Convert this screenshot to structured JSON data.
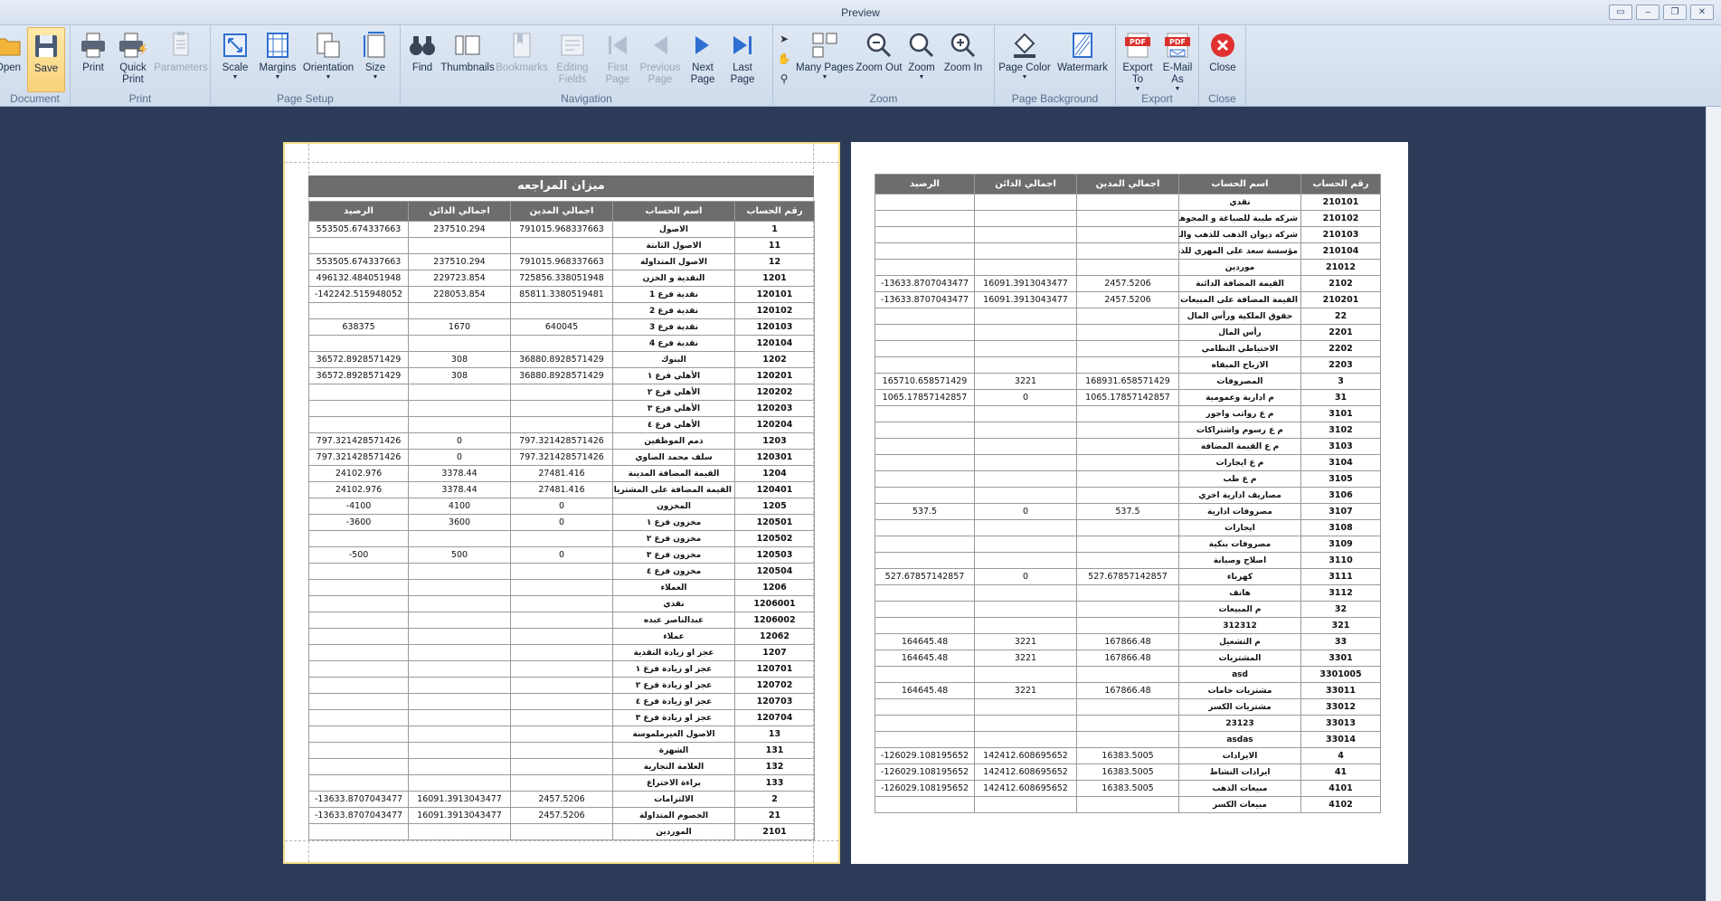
{
  "window": {
    "title": "Preview"
  },
  "ribbon": {
    "groups": {
      "document": "Document",
      "print": "Print",
      "page_setup": "Page Setup",
      "navigation": "Navigation",
      "zoom": "Zoom",
      "page_background": "Page Background",
      "export": "Export",
      "close": "Close"
    },
    "buttons": {
      "open": "Open",
      "save": "Save",
      "print": "Print",
      "quick_print": "Quick Print",
      "parameters": "Parameters",
      "scale": "Scale",
      "margins": "Margins",
      "orientation": "Orientation",
      "size": "Size",
      "find": "Find",
      "thumbnails": "Thumbnails",
      "bookmarks": "Bookmarks",
      "editing_fields": "Editing Fields",
      "first_page": "First Page",
      "previous_page": "Previous Page",
      "next_page": "Next Page",
      "last_page": "Last Page",
      "many_pages": "Many Pages",
      "zoom_out": "Zoom Out",
      "zoom": "Zoom",
      "zoom_in": "Zoom In",
      "page_color": "Page Color",
      "watermark": "Watermark",
      "export_to": "Export To",
      "email_as": "E-Mail As",
      "close": "Close"
    }
  },
  "report": {
    "title": "ميزان المراجعه",
    "headers": [
      "الرصيد",
      "اجمالي الدائن",
      "اجمالي المدين",
      "اسم الحساب",
      "رقم الحساب"
    ],
    "page1_rows": [
      [
        "553505.674337663",
        "237510.294",
        "791015.968337663",
        "الاصول",
        "1"
      ],
      [
        "",
        "",
        "",
        "الاصول الثابتة",
        "11"
      ],
      [
        "553505.674337663",
        "237510.294",
        "791015.968337663",
        "الاصول المتداولة",
        "12"
      ],
      [
        "496132.484051948",
        "229723.854",
        "725856.338051948",
        "النقدية و الخزن",
        "1201"
      ],
      [
        "-142242.515948052",
        "228053.854",
        "85811.3380519481",
        "نقدية فرع 1",
        "120101"
      ],
      [
        "",
        "",
        "",
        "نقدية فرع 2",
        "120102"
      ],
      [
        "638375",
        "1670",
        "640045",
        "نقدية فرع 3",
        "120103"
      ],
      [
        "",
        "",
        "",
        "نقدية فرع 4",
        "120104"
      ],
      [
        "36572.8928571429",
        "308",
        "36880.8928571429",
        "البنوك",
        "1202"
      ],
      [
        "36572.8928571429",
        "308",
        "36880.8928571429",
        "الأهلي فرع ١",
        "120201"
      ],
      [
        "",
        "",
        "",
        "الأهلي فرع ٢",
        "120202"
      ],
      [
        "",
        "",
        "",
        "الأهلي فرع ٣",
        "120203"
      ],
      [
        "",
        "",
        "",
        "الأهلي فرع ٤",
        "120204"
      ],
      [
        "797.321428571426",
        "0",
        "797.321428571426",
        "ذمم الموظفين",
        "1203"
      ],
      [
        "797.321428571426",
        "0",
        "797.321428571426",
        "سلف محمد الصاوي",
        "120301"
      ],
      [
        "24102.976",
        "3378.44",
        "27481.416",
        "القيمة المضافة المدينة",
        "1204"
      ],
      [
        "24102.976",
        "3378.44",
        "27481.416",
        "القيمة المضافة على المشتريات",
        "120401"
      ],
      [
        "-4100",
        "4100",
        "0",
        "المخزون",
        "1205"
      ],
      [
        "-3600",
        "3600",
        "0",
        "مخزون فرع ١",
        "120501"
      ],
      [
        "",
        "",
        "",
        "مخزون فرع ٢",
        "120502"
      ],
      [
        "-500",
        "500",
        "0",
        "مخزون فرع ٣",
        "120503"
      ],
      [
        "",
        "",
        "",
        "مخزون فرع ٤",
        "120504"
      ],
      [
        "",
        "",
        "",
        "العملاء",
        "1206"
      ],
      [
        "",
        "",
        "",
        "نقدي",
        "1206001"
      ],
      [
        "",
        "",
        "",
        "عبدالناصر عبده",
        "1206002"
      ],
      [
        "",
        "",
        "",
        "عملاء",
        "12062"
      ],
      [
        "",
        "",
        "",
        "عجز او زيادة النقدية",
        "1207"
      ],
      [
        "",
        "",
        "",
        "عجز او زيادة فرع ١",
        "120701"
      ],
      [
        "",
        "",
        "",
        "عجز او زيادة فرع ٢",
        "120702"
      ],
      [
        "",
        "",
        "",
        "عجز او زيادة فرع ٤",
        "120703"
      ],
      [
        "",
        "",
        "",
        "عجز او زيادة فرع ٣",
        "120704"
      ],
      [
        "",
        "",
        "",
        "الاصول الغيرملموسة",
        "13"
      ],
      [
        "",
        "",
        "",
        "الشهرة",
        "131"
      ],
      [
        "",
        "",
        "",
        "العلامة التجارية",
        "132"
      ],
      [
        "",
        "",
        "",
        "براءة الاختراع",
        "133"
      ],
      [
        "-13633.8707043477",
        "16091.3913043477",
        "2457.5206",
        "الالتزامات",
        "2"
      ],
      [
        "-13633.8707043477",
        "16091.3913043477",
        "2457.5206",
        "الخصوم المتداولة",
        "21"
      ],
      [
        "",
        "",
        "",
        "الموردين",
        "2101"
      ]
    ],
    "page2_rows": [
      [
        "",
        "",
        "",
        "نقدي",
        "210101"
      ],
      [
        "",
        "",
        "",
        "شركه طيبة للصياغة و المجوهرات المحدودة",
        "210102"
      ],
      [
        "",
        "",
        "",
        "شركه ديوان الذهب للذهب والمجوهرات",
        "210103"
      ],
      [
        "",
        "",
        "",
        "مؤسسة سعد على المهري للذهب",
        "210104"
      ],
      [
        "",
        "",
        "",
        "موردين",
        "21012"
      ],
      [
        "-13633.8707043477",
        "16091.3913043477",
        "2457.5206",
        "القيمة المضافة الدائنة",
        "2102"
      ],
      [
        "-13633.8707043477",
        "16091.3913043477",
        "2457.5206",
        "القيمة المضافة على المبيعات",
        "210201"
      ],
      [
        "",
        "",
        "",
        "حقوق الملكية ورأس المال",
        "22"
      ],
      [
        "",
        "",
        "",
        "رأس المال",
        "2201"
      ],
      [
        "",
        "",
        "",
        "الاحتياطي النظامي",
        "2202"
      ],
      [
        "",
        "",
        "",
        "الارباح المبقاه",
        "2203"
      ],
      [
        "165710.658571429",
        "3221",
        "168931.658571429",
        "المصروفات",
        "3"
      ],
      [
        "1065.17857142857",
        "0",
        "1065.17857142857",
        "م ادارية وعمومية",
        "31"
      ],
      [
        "",
        "",
        "",
        "م ع رواتب واجور",
        "3101"
      ],
      [
        "",
        "",
        "",
        "م ع رسوم واشتراكات",
        "3102"
      ],
      [
        "",
        "",
        "",
        "م ع القيمة المضافة",
        "3103"
      ],
      [
        "",
        "",
        "",
        "م ع ايجارات",
        "3104"
      ],
      [
        "",
        "",
        "",
        "م ع طب",
        "3105"
      ],
      [
        "",
        "",
        "",
        "مصاريف ادارية اخري",
        "3106"
      ],
      [
        "537.5",
        "0",
        "537.5",
        "مصروفات ادارية",
        "3107"
      ],
      [
        "",
        "",
        "",
        "ايجارات",
        "3108"
      ],
      [
        "",
        "",
        "",
        "مصروفات بنكية",
        "3109"
      ],
      [
        "",
        "",
        "",
        "اصلاح وصيانة",
        "3110"
      ],
      [
        "527.67857142857",
        "0",
        "527.67857142857",
        "كهرباء",
        "3111"
      ],
      [
        "",
        "",
        "",
        "هاتف",
        "3112"
      ],
      [
        "",
        "",
        "",
        "م المبيعات",
        "32"
      ],
      [
        "",
        "",
        "",
        "312312",
        "321"
      ],
      [
        "164645.48",
        "3221",
        "167866.48",
        "م التشغيل",
        "33"
      ],
      [
        "164645.48",
        "3221",
        "167866.48",
        "المشتريات",
        "3301"
      ],
      [
        "",
        "",
        "",
        "asd",
        "3301005"
      ],
      [
        "164645.48",
        "3221",
        "167866.48",
        "مشتريات خامات",
        "33011"
      ],
      [
        "",
        "",
        "",
        "مشتريات الكسر",
        "33012"
      ],
      [
        "",
        "",
        "",
        "23123",
        "33013"
      ],
      [
        "",
        "",
        "",
        "asdas",
        "33014"
      ],
      [
        "-126029.108195652",
        "142412.608695652",
        "16383.5005",
        "الايرادات",
        "4"
      ],
      [
        "-126029.108195652",
        "142412.608695652",
        "16383.5005",
        "ايرادات النشاط",
        "41"
      ],
      [
        "-126029.108195652",
        "142412.608695652",
        "16383.5005",
        "مبيعات الذهب",
        "4101"
      ],
      [
        "",
        "",
        "",
        "مبيعات الكسر",
        "4102"
      ]
    ]
  },
  "colors": {
    "ribbon_bg": "#d6e1ef",
    "viewport_bg": "#2c3b57",
    "table_header": "#6d6d6d",
    "active_button": "#f9d27a",
    "nav_blue": "#2f6fd1",
    "pdf_red": "#d9302c"
  }
}
